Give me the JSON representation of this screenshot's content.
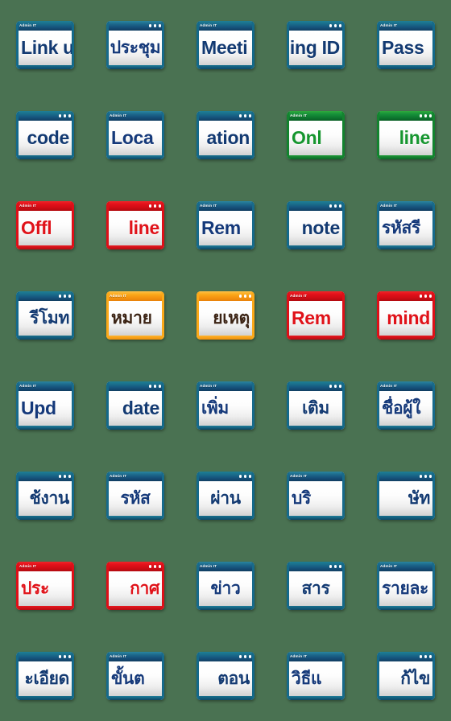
{
  "sheet": {
    "background_color": "#4a7252",
    "columns": 5,
    "rows": 8,
    "title_label": "Admin IT",
    "themes": {
      "teal": "#16567f",
      "blue": "#16507a",
      "green": "#0e7a30",
      "red": "#d00d15",
      "orange": "#f59310"
    }
  },
  "stickers": [
    {
      "text": "Link u",
      "script": "latin",
      "theme": "teal",
      "titlebar": "label",
      "clip": "right"
    },
    {
      "text": "ประชุม",
      "script": "thai",
      "theme": "blue",
      "titlebar": "dots",
      "clip": "none"
    },
    {
      "text": "Meeti",
      "script": "latin",
      "theme": "teal",
      "titlebar": "label",
      "clip": "right"
    },
    {
      "text": "ing ID",
      "script": "latin",
      "theme": "teal",
      "titlebar": "dots",
      "clip": "left"
    },
    {
      "text": "Pass",
      "script": "latin",
      "theme": "teal",
      "titlebar": "label",
      "clip": "right"
    },
    {
      "text": "code",
      "script": "latin",
      "theme": "teal",
      "titlebar": "dots",
      "clip": "left"
    },
    {
      "text": "Loca",
      "script": "latin",
      "theme": "blue",
      "titlebar": "label",
      "clip": "right"
    },
    {
      "text": "ation",
      "script": "latin",
      "theme": "teal",
      "titlebar": "dots",
      "clip": "left"
    },
    {
      "text": "Onl",
      "script": "latin",
      "theme": "green",
      "titlebar": "label",
      "clip": "right"
    },
    {
      "text": "line",
      "script": "latin",
      "theme": "green",
      "titlebar": "dots",
      "clip": "left"
    },
    {
      "text": "Offl",
      "script": "latin",
      "theme": "red",
      "titlebar": "label",
      "clip": "right"
    },
    {
      "text": "line",
      "script": "latin",
      "theme": "red",
      "titlebar": "dots",
      "clip": "left"
    },
    {
      "text": "Rem",
      "script": "latin",
      "theme": "blue",
      "titlebar": "label",
      "clip": "right"
    },
    {
      "text": "note",
      "script": "latin",
      "theme": "teal",
      "titlebar": "dots",
      "clip": "left"
    },
    {
      "text": "รหัสรี",
      "script": "thai",
      "theme": "blue",
      "titlebar": "label",
      "clip": "right"
    },
    {
      "text": "รีโมท",
      "script": "thai",
      "theme": "teal",
      "titlebar": "dots",
      "clip": "left"
    },
    {
      "text": "หมาย",
      "script": "thai",
      "theme": "orange",
      "titlebar": "label",
      "clip": "right"
    },
    {
      "text": "ยเหตุ",
      "script": "thai",
      "theme": "orange",
      "titlebar": "dots",
      "clip": "left"
    },
    {
      "text": "Rem",
      "script": "latin",
      "theme": "red",
      "titlebar": "label",
      "clip": "right"
    },
    {
      "text": "mind",
      "script": "latin",
      "theme": "red",
      "titlebar": "dots",
      "clip": "left"
    },
    {
      "text": "Upd",
      "script": "latin",
      "theme": "blue",
      "titlebar": "label",
      "clip": "right"
    },
    {
      "text": "date",
      "script": "latin",
      "theme": "teal",
      "titlebar": "dots",
      "clip": "left"
    },
    {
      "text": "เพิ่ม",
      "script": "thai",
      "theme": "blue",
      "titlebar": "label",
      "clip": "right"
    },
    {
      "text": "เติม",
      "script": "thai",
      "theme": "teal",
      "titlebar": "dots",
      "clip": "none"
    },
    {
      "text": "ชื่อผู้ใ",
      "script": "thai",
      "theme": "blue",
      "titlebar": "label",
      "clip": "right"
    },
    {
      "text": "ช้งาน",
      "script": "thai",
      "theme": "teal",
      "titlebar": "dots",
      "clip": "left"
    },
    {
      "text": "รหัส",
      "script": "thai",
      "theme": "blue",
      "titlebar": "label",
      "clip": "none"
    },
    {
      "text": "ผ่าน",
      "script": "thai",
      "theme": "teal",
      "titlebar": "dots",
      "clip": "none"
    },
    {
      "text": "บริ",
      "script": "thai",
      "theme": "blue",
      "titlebar": "label",
      "clip": "right"
    },
    {
      "text": "ษัท",
      "script": "thai",
      "theme": "teal",
      "titlebar": "dots",
      "clip": "left"
    },
    {
      "text": "ประ",
      "script": "thai",
      "theme": "red",
      "titlebar": "label",
      "clip": "right"
    },
    {
      "text": "กาศ",
      "script": "thai",
      "theme": "red",
      "titlebar": "dots",
      "clip": "left"
    },
    {
      "text": "ข่าว",
      "script": "thai",
      "theme": "blue",
      "titlebar": "label",
      "clip": "none"
    },
    {
      "text": "สาร",
      "script": "thai",
      "theme": "teal",
      "titlebar": "dots",
      "clip": "none"
    },
    {
      "text": "รายละ",
      "script": "thai",
      "theme": "blue",
      "titlebar": "label",
      "clip": "right"
    },
    {
      "text": "ะเอียด",
      "script": "thai",
      "theme": "teal",
      "titlebar": "dots",
      "clip": "left"
    },
    {
      "text": "ขั้นต",
      "script": "thai",
      "theme": "blue",
      "titlebar": "label",
      "clip": "right"
    },
    {
      "text": "ตอน",
      "script": "thai",
      "theme": "teal",
      "titlebar": "dots",
      "clip": "left"
    },
    {
      "text": "วิธีแ",
      "script": "thai",
      "theme": "blue",
      "titlebar": "label",
      "clip": "right"
    },
    {
      "text": "ก้ไข",
      "script": "thai",
      "theme": "teal",
      "titlebar": "dots",
      "clip": "left"
    }
  ]
}
